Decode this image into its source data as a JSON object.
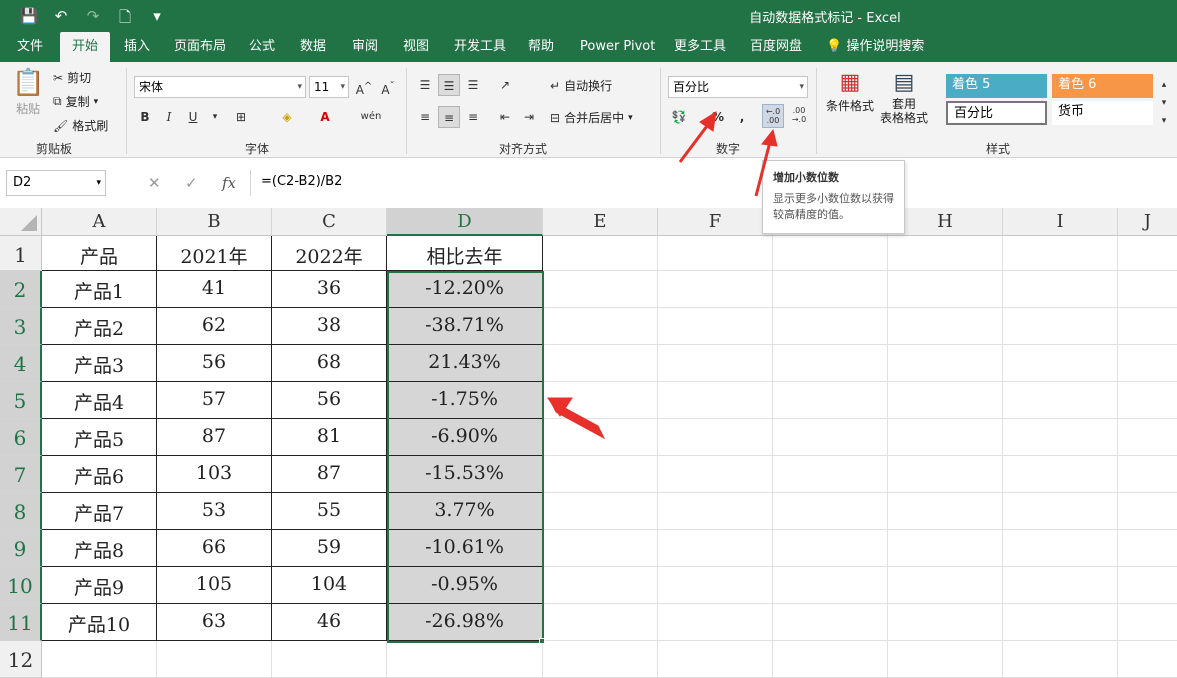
{
  "window": {
    "title": "自动数据格式标记  -  Excel"
  },
  "tabs": [
    "文件",
    "开始",
    "插入",
    "页面布局",
    "公式",
    "数据",
    "审阅",
    "视图",
    "开发工具",
    "帮助",
    "Power Pivot",
    "更多工具",
    "百度网盘",
    "操作说明搜索"
  ],
  "ribbon": {
    "clipboard": {
      "paste": "粘贴",
      "cut": "剪切",
      "copy": "复制",
      "format_painter": "格式刷",
      "label": "剪贴板"
    },
    "font": {
      "name": "宋体",
      "size": "11",
      "bold": "B",
      "italic": "I",
      "underline": "U",
      "label": "字体"
    },
    "alignment": {
      "wrap": "自动换行",
      "merge": "合并后居中",
      "label": "对齐方式"
    },
    "number": {
      "format": "百分比",
      "percent": "%",
      "comma": ",",
      "inc_decimal": "←.0\n.00",
      "dec_decimal": ".00\n→.0",
      "label": "数字"
    },
    "styles": {
      "conditional": "条件格式",
      "table": "套用\n表格格式",
      "accent5": "着色 5",
      "accent6": "着色 6",
      "percent": "百分比",
      "currency": "货币",
      "label": "样式"
    }
  },
  "tooltip": {
    "title": "增加小数位数",
    "description": "显示更多小数位数以获得较高精度的值。"
  },
  "formula_bar": {
    "name_box": "D2",
    "formula": "=(C2-B2)/B2",
    "fx": "fx"
  },
  "sheet": {
    "columns": [
      "A",
      "B",
      "C",
      "D",
      "E",
      "F",
      "G",
      "H",
      "I",
      "J"
    ],
    "rows": [
      "1",
      "2",
      "3",
      "4",
      "5",
      "6",
      "7",
      "8",
      "9",
      "10",
      "11",
      "12"
    ],
    "header": [
      "产品",
      "2021年",
      "2022年",
      "相比去年"
    ],
    "data": [
      [
        "产品1",
        "41",
        "36",
        "-12.20%"
      ],
      [
        "产品2",
        "62",
        "38",
        "-38.71%"
      ],
      [
        "产品3",
        "56",
        "68",
        "21.43%"
      ],
      [
        "产品4",
        "57",
        "56",
        "-1.75%"
      ],
      [
        "产品5",
        "87",
        "81",
        "-6.90%"
      ],
      [
        "产品6",
        "103",
        "87",
        "-15.53%"
      ],
      [
        "产品7",
        "53",
        "55",
        "3.77%"
      ],
      [
        "产品8",
        "66",
        "59",
        "-10.61%"
      ],
      [
        "产品9",
        "105",
        "104",
        "-0.95%"
      ],
      [
        "产品10",
        "63",
        "46",
        "-26.98%"
      ]
    ]
  },
  "colors": {
    "excel_green": "#217346",
    "accent5": "#4bacc6",
    "accent6": "#f79646",
    "selection": "#d6d6d6",
    "arrow": "#e8302a"
  }
}
